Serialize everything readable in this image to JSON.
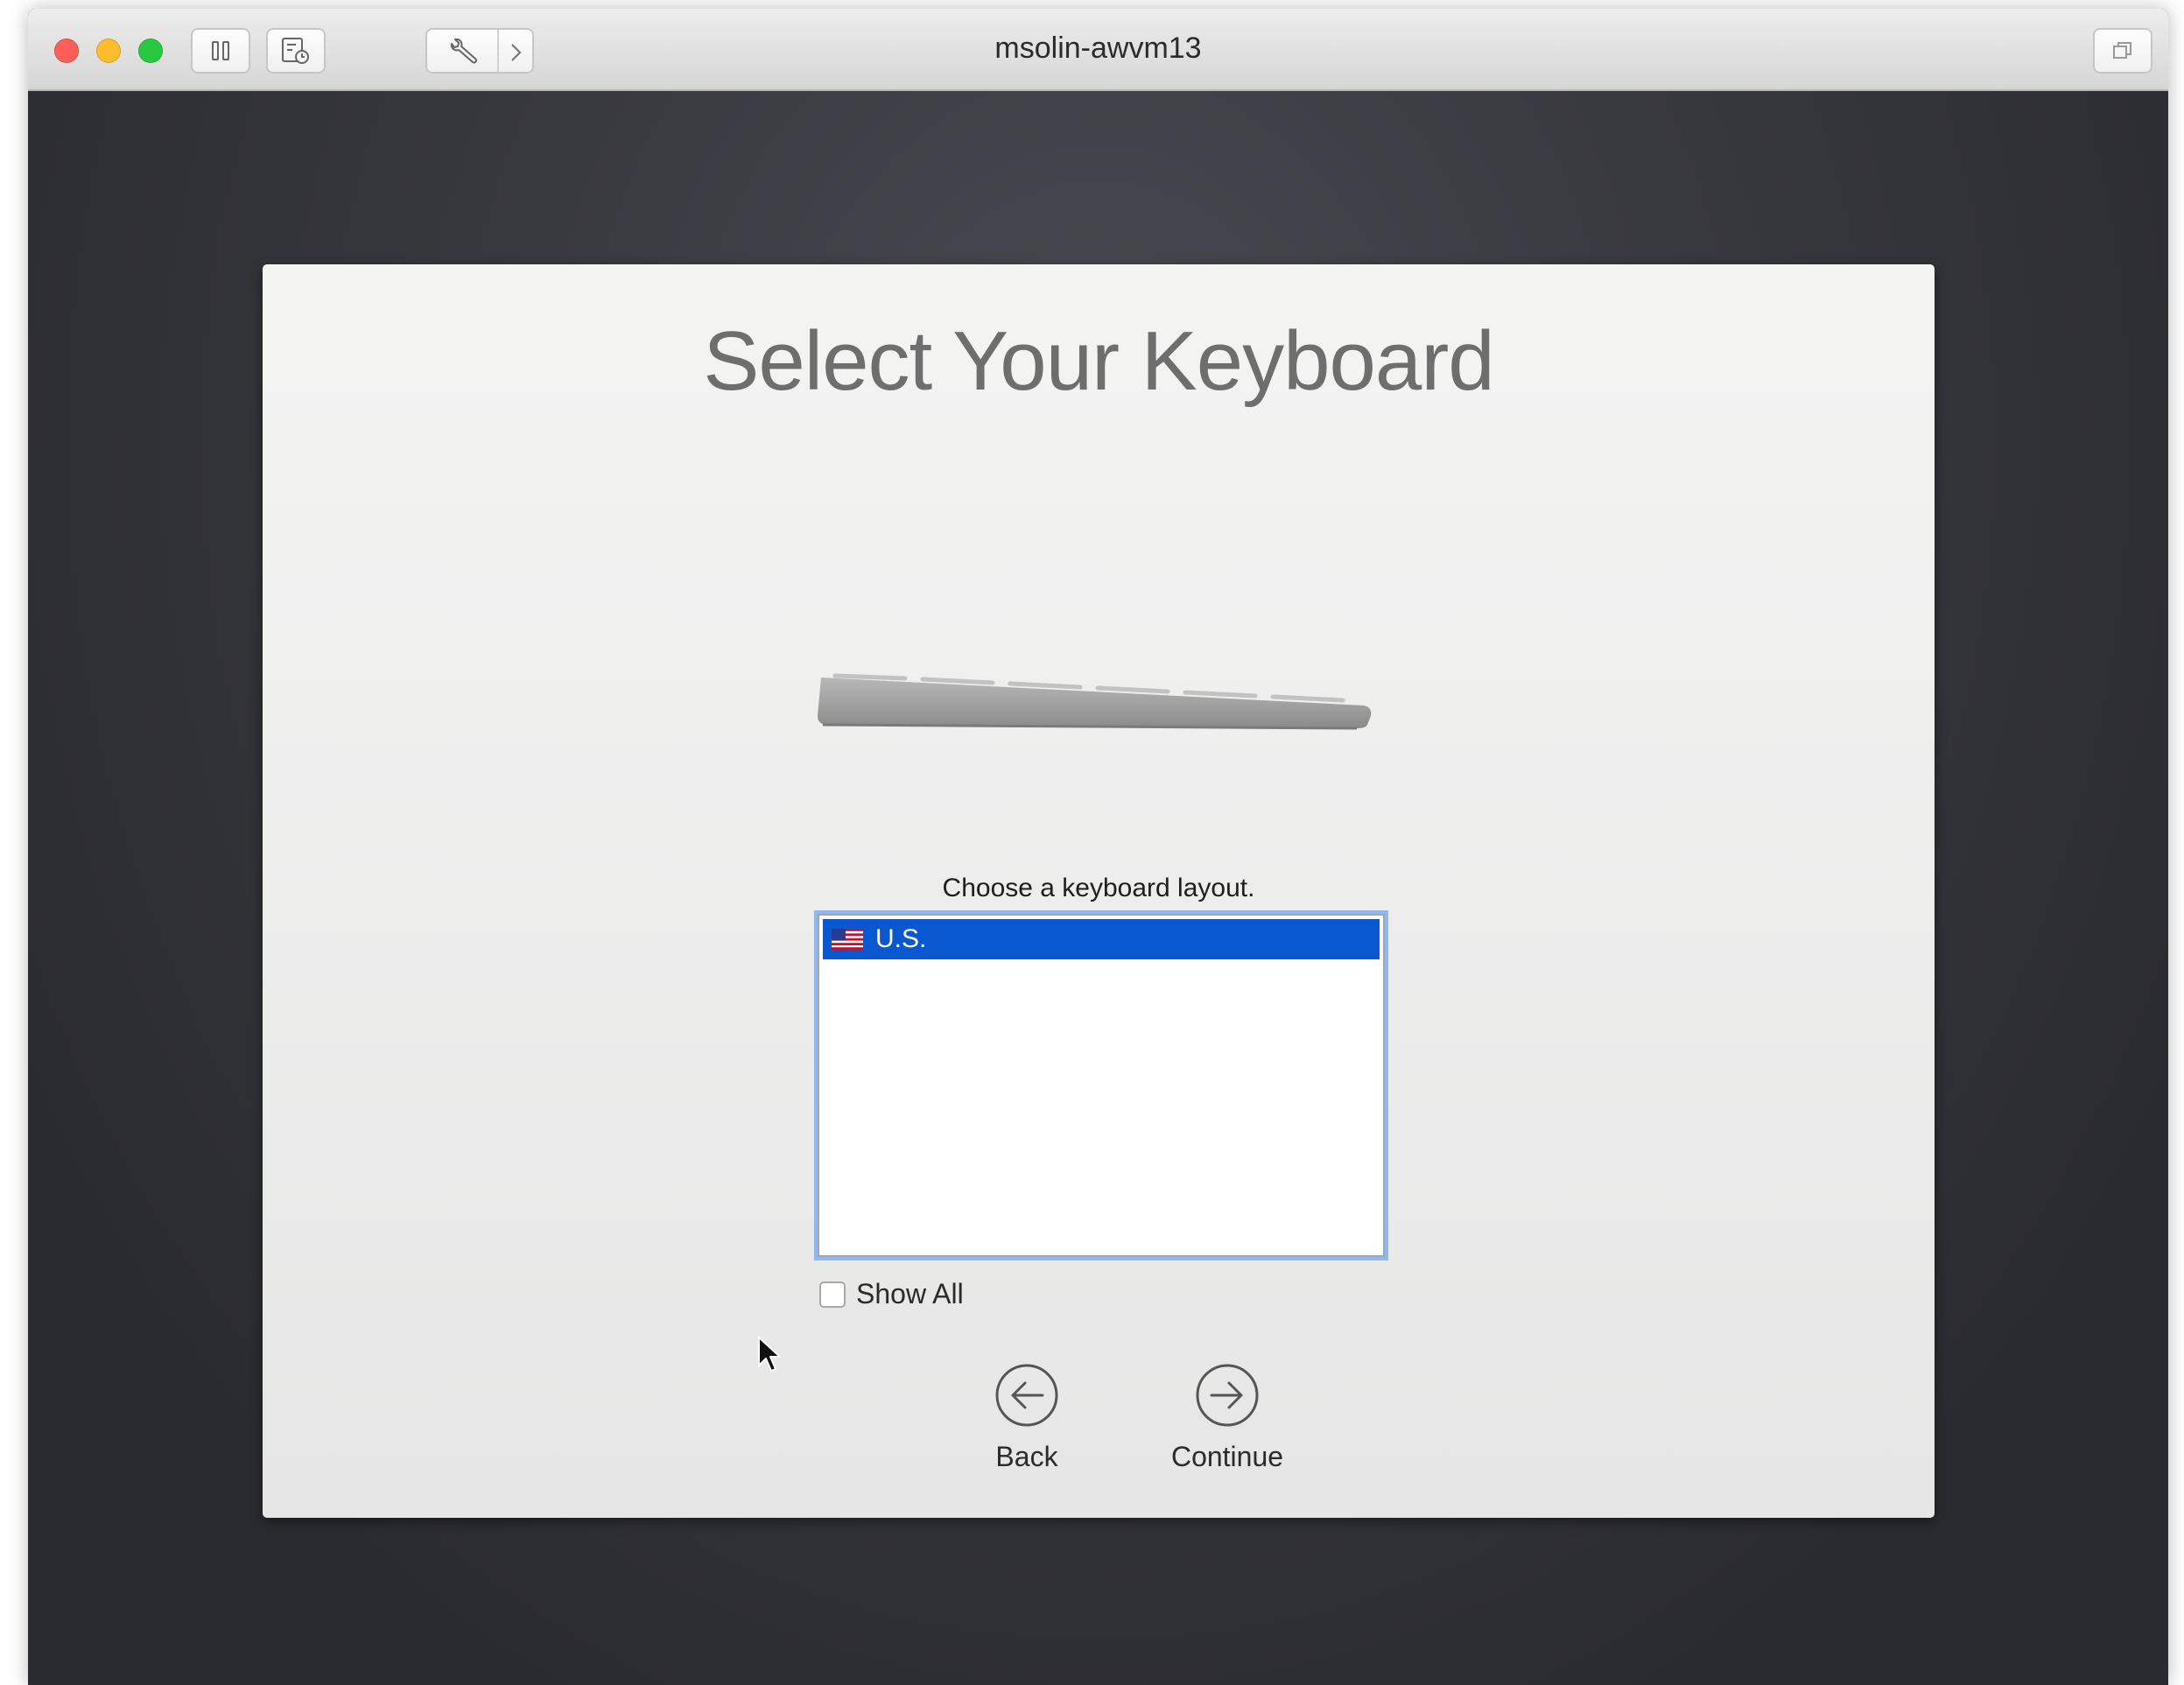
{
  "window": {
    "title": "msolin-awvm13",
    "toolbar": {
      "icons": [
        "pause-icon",
        "snapshot-icon",
        "settings-wrench-icon",
        "chevron-right-icon",
        "restore-window-icon"
      ]
    }
  },
  "setup": {
    "title": "Select Your Keyboard",
    "prompt": "Choose a keyboard layout.",
    "layouts": [
      {
        "label": "U.S.",
        "icon": "us-flag-icon",
        "selected": true
      }
    ],
    "show_all": {
      "label": "Show All",
      "checked": false
    },
    "back_label": "Back",
    "continue_label": "Continue"
  },
  "colors": {
    "selection": "#0a58d0",
    "focus_ring": "#8fb7f2",
    "close": "#fc5f57",
    "minimize": "#fdbc2e",
    "zoom": "#28c840"
  }
}
